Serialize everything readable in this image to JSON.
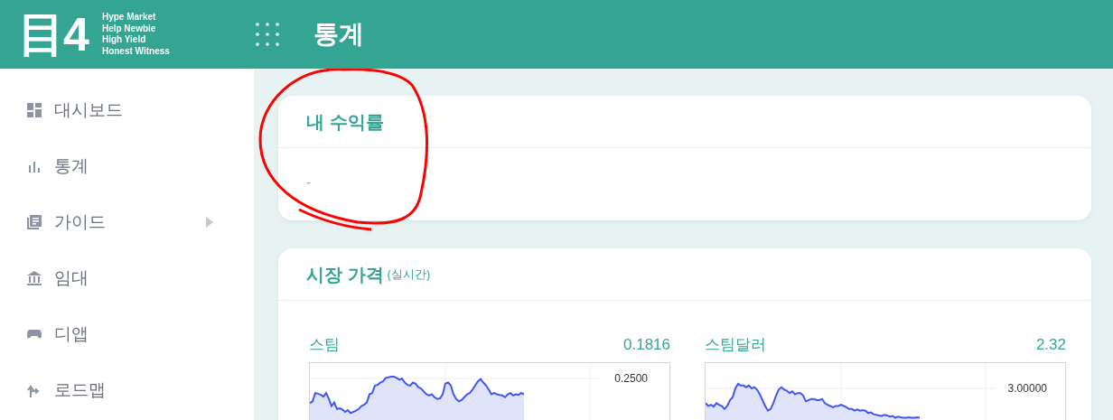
{
  "header": {
    "logo": "目4",
    "slogan": [
      "Hype Market",
      "Help Newbie",
      "High Yield",
      "Honest Witness"
    ],
    "page_title": "통계"
  },
  "sidebar": {
    "items": [
      {
        "label": "대시보드",
        "submenu": false
      },
      {
        "label": "통계",
        "submenu": false
      },
      {
        "label": "가이드",
        "submenu": true
      },
      {
        "label": "임대",
        "submenu": false
      },
      {
        "label": "디앱",
        "submenu": false
      },
      {
        "label": "로드맵",
        "submenu": false
      }
    ]
  },
  "profit_card": {
    "title": "내 수익률",
    "value": "-",
    "annotated": true
  },
  "market_card": {
    "title": "시장 가격",
    "note": "(실시간)",
    "prices": [
      {
        "name": "스팀",
        "price": "0.1816",
        "tick": "0.2500"
      },
      {
        "name": "스팀달러",
        "price": "2.32",
        "tick": "3.00000"
      }
    ]
  }
}
